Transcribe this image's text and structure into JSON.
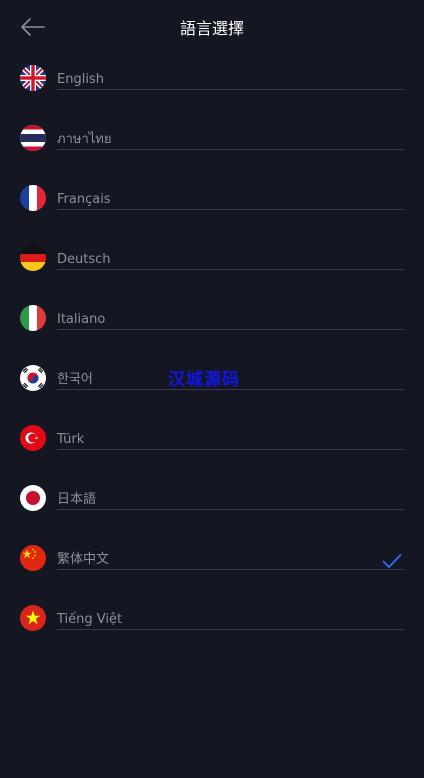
{
  "header": {
    "title": "語言選擇",
    "back_icon": "arrow-left-icon"
  },
  "languages": [
    {
      "label": "English",
      "flag": "uk-flag-icon",
      "selected": false
    },
    {
      "label": "ภาษาไทย",
      "flag": "thailand-flag-icon",
      "selected": false
    },
    {
      "label": "Français",
      "flag": "france-flag-icon",
      "selected": false
    },
    {
      "label": "Deutsch",
      "flag": "germany-flag-icon",
      "selected": false
    },
    {
      "label": "Italiano",
      "flag": "italy-flag-icon",
      "selected": false
    },
    {
      "label": "한국어",
      "flag": "korea-flag-icon",
      "selected": false
    },
    {
      "label": "Türk",
      "flag": "turkey-flag-icon",
      "selected": false
    },
    {
      "label": "日本語",
      "flag": "japan-flag-icon",
      "selected": false
    },
    {
      "label": "繁体中文",
      "flag": "china-flag-icon",
      "selected": true
    },
    {
      "label": "Tiếng Việt",
      "flag": "vietnam-flag-icon",
      "selected": false
    }
  ],
  "watermark": "汉城源码",
  "colors": {
    "background": "#141722",
    "text_primary": "#ffffff",
    "text_secondary": "#8a8f9f",
    "divider": "#363a4a",
    "accent": "#2f6bff"
  }
}
